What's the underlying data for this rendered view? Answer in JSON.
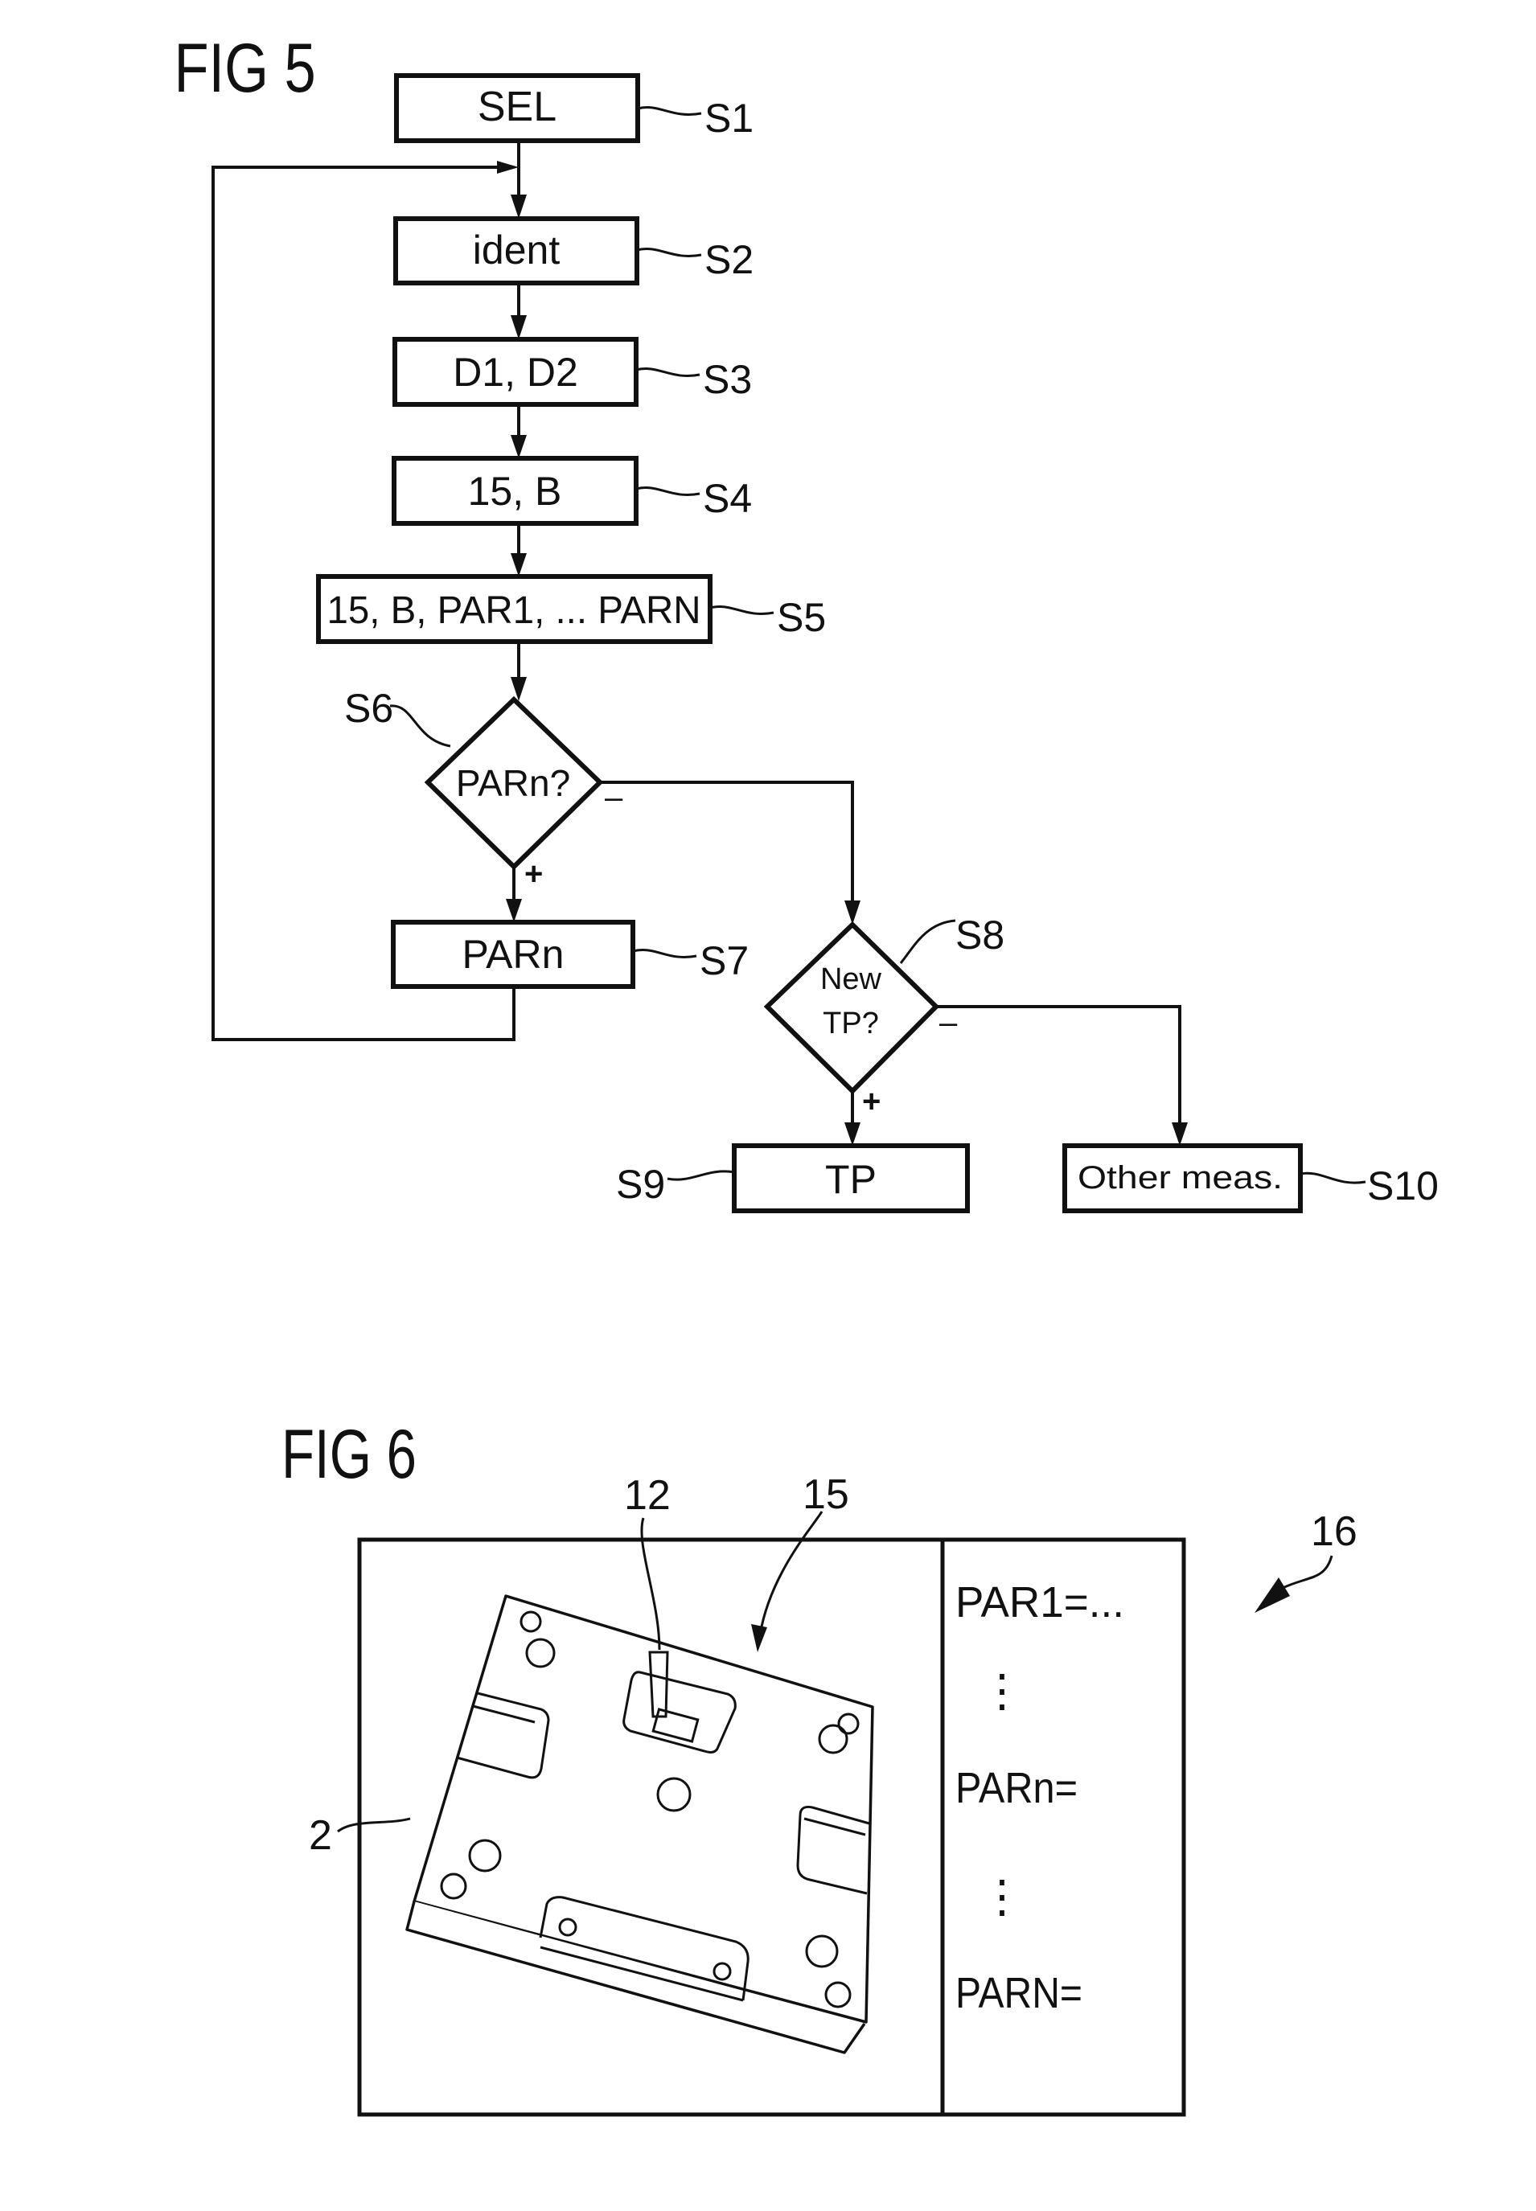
{
  "fig5": {
    "title": "FIG 5",
    "steps": [
      {
        "id": "S1",
        "text": "SEL",
        "shape": "box"
      },
      {
        "id": "S2",
        "text": "ident",
        "shape": "box"
      },
      {
        "id": "S3",
        "text": "D1, D2",
        "shape": "box"
      },
      {
        "id": "S4",
        "text": "15, B",
        "shape": "box"
      },
      {
        "id": "S5",
        "text": "15, B, PAR1, ... PARN",
        "shape": "box"
      },
      {
        "id": "S6",
        "text": "PARn?",
        "shape": "decision"
      },
      {
        "id": "S7",
        "text": "PARn",
        "shape": "box"
      },
      {
        "id": "S8",
        "text_lines": [
          "New",
          "TP?"
        ],
        "shape": "decision"
      },
      {
        "id": "S9",
        "text": "TP",
        "shape": "box"
      },
      {
        "id": "S10",
        "text": "Other meas.",
        "shape": "box"
      }
    ],
    "branch_labels": {
      "s6_yes": "+",
      "s6_no": "–",
      "s8_yes": "+",
      "s8_no": "–"
    }
  },
  "fig6": {
    "title": "FIG 6",
    "refs": {
      "part": "2",
      "probe": "12",
      "image": "15",
      "screen": "16"
    },
    "params": [
      "PAR1=...",
      "PARn=",
      "PARN="
    ],
    "ellipsis": "⋮"
  }
}
